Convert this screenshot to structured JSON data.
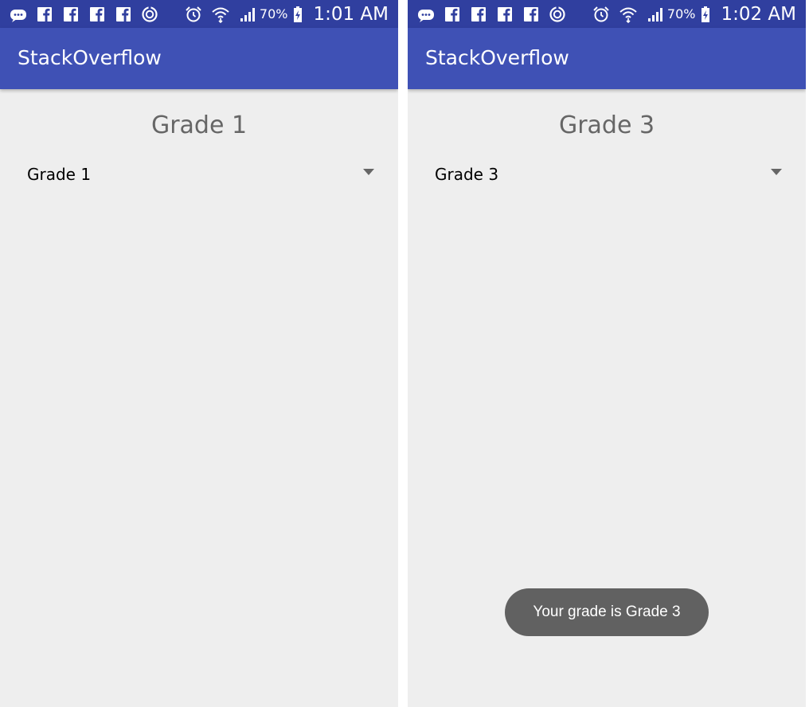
{
  "colors": {
    "status_bar": "#303f9f",
    "app_bar": "#3f51b5",
    "background": "#eeeeee",
    "heading_text": "#666666",
    "toast_background": "#616161"
  },
  "status_icons": [
    "messenger-icon",
    "facebook-icon",
    "facebook-icon",
    "facebook-icon",
    "facebook-icon",
    "sync-icon",
    "alarm-icon",
    "wifi-icon",
    "cell-signal-icon",
    "battery-charging-icon"
  ],
  "screens": [
    {
      "status_bar": {
        "battery_percent": "70%",
        "time": "1:01 AM"
      },
      "app_bar": {
        "title": "StackOverflow"
      },
      "heading": "Grade 1",
      "spinner": {
        "selected": "Grade 1"
      }
    },
    {
      "status_bar": {
        "battery_percent": "70%",
        "time": "1:02 AM"
      },
      "app_bar": {
        "title": "StackOverflow"
      },
      "heading": "Grade 3",
      "spinner": {
        "selected": "Grade 3"
      },
      "toast": {
        "text": "Your grade is Grade 3"
      }
    }
  ]
}
